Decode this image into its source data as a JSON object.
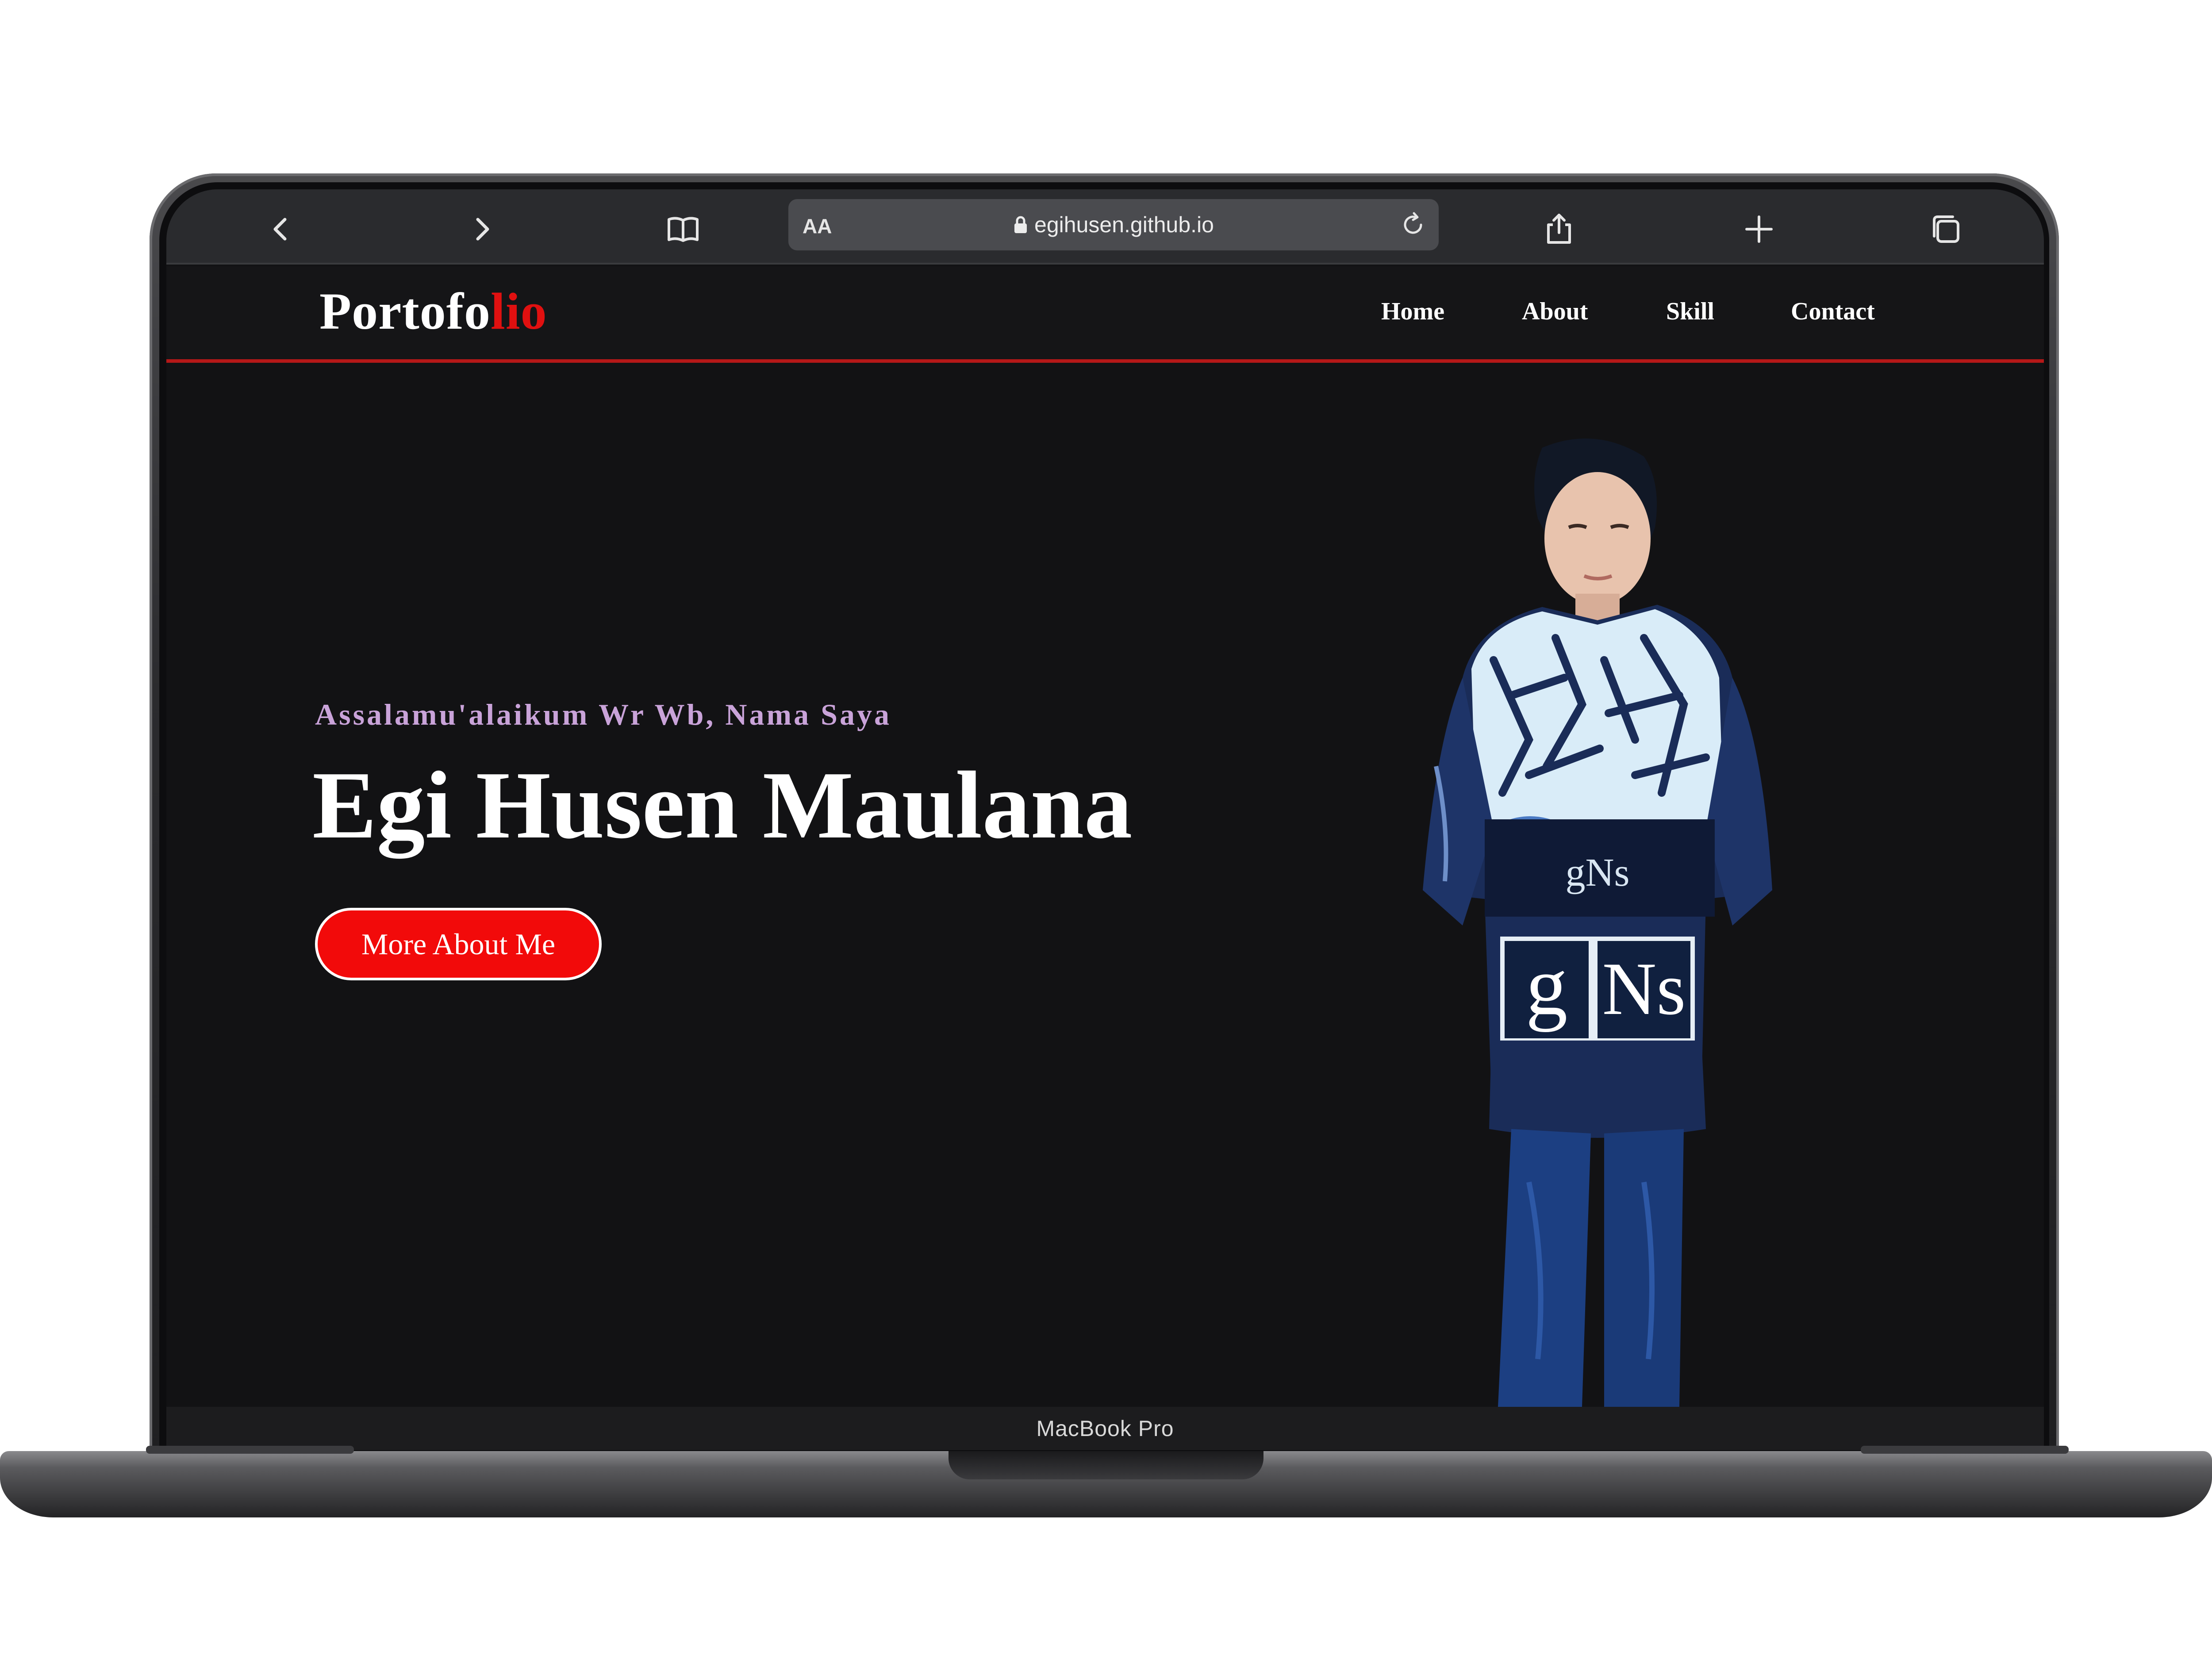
{
  "device": {
    "model_label": "MacBook Pro"
  },
  "browser": {
    "text_size_label": "AA",
    "url": "egihusen.github.io",
    "icons": {
      "back": "chevron-left-icon",
      "forward": "chevron-right-icon",
      "bookmarks": "book-icon",
      "lock": "lock-icon",
      "reload": "reload-icon",
      "share": "share-icon",
      "new_tab": "plus-icon",
      "tabs": "tabs-icon"
    }
  },
  "site": {
    "brand": {
      "main": "Portofo",
      "accent": "lio"
    },
    "nav": [
      {
        "label": "Home"
      },
      {
        "label": "About"
      },
      {
        "label": "Skill"
      },
      {
        "label": "Contact"
      }
    ],
    "hero": {
      "greeting": "Assalamu'alaikum Wr Wb, Nama Saya",
      "name": "Egi Husen Maulana",
      "cta_label": "More About Me",
      "photo_jacket_text_top": "gNs",
      "photo_jacket_text_bottom_1": "g",
      "photo_jacket_text_bottom_2": "Ns"
    },
    "colors": {
      "accent_red": "#e01010",
      "button_red": "#f20a0a",
      "background": "#121214",
      "greeting_color": "#c9a3d9",
      "nav_border": "#b51818"
    }
  }
}
